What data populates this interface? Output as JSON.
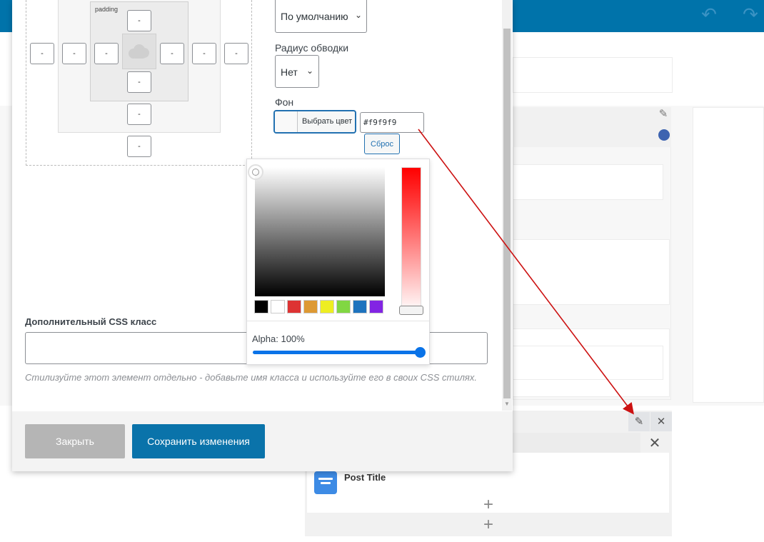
{
  "topbar": {
    "undo_icon": "undo-icon",
    "redo_icon": "redo-icon",
    "undo_glyph": "↶",
    "redo_glyph": "↷"
  },
  "box_model": {
    "padding_label": "padding",
    "value": "-"
  },
  "fields": {
    "style_select": "По умолчанию",
    "radius_label": "Радиус обводки",
    "radius_select": "Нет",
    "bg_label": "Фон",
    "pick_color_button": "Выбрать цвет",
    "hex_value": "#f9f9f9",
    "reset_button": "Сброс",
    "css_class_label": "Дополнительный CSS класс",
    "css_class_value": "",
    "css_class_desc": "Стилизуйте этот элемент отдельно - добавьте имя класса и используйте его в своих CSS стилях."
  },
  "color_picker": {
    "alpha_label": "Alpha: 100%",
    "alpha_value": 1.0,
    "palette": [
      "#000000",
      "#ffffff",
      "#dd3333",
      "#dd9933",
      "#eeee22",
      "#81d742",
      "#1e73be",
      "#8224e3"
    ],
    "strip_color": "#ff0000"
  },
  "footer": {
    "close_button": "Закрыть",
    "save_button": "Сохранить изменения"
  },
  "widget": {
    "post_title": "Post Title",
    "edit_glyph": "✎",
    "close_glyph": "✕",
    "add_glyph": "+"
  },
  "colors": {
    "topbar": "#0073aa",
    "save_button": "#0a73aa",
    "close_button": "#b5b5b5",
    "accent_blue": "#2271b1",
    "annotation_arrow": "#cc1111"
  }
}
